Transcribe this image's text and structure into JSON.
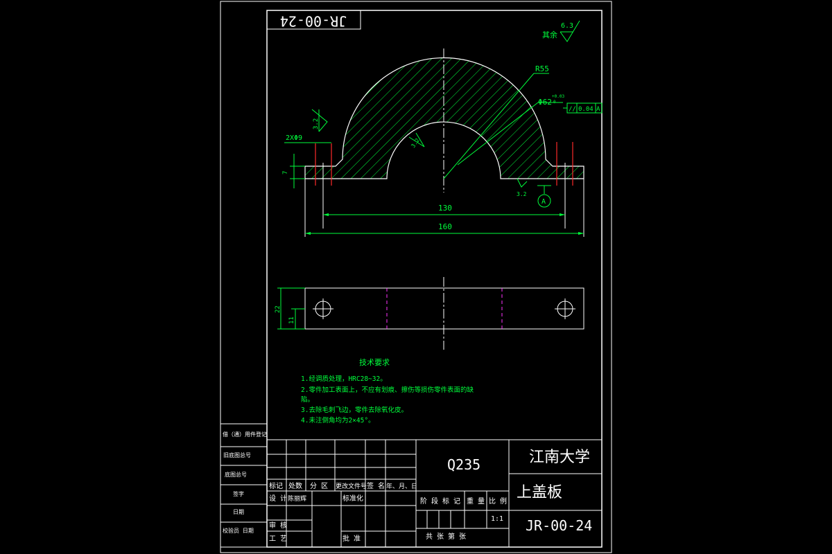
{
  "drawing_number_mirrored": "JR-00-24",
  "surface_finish_other": {
    "label": "其余",
    "value": "6.3"
  },
  "dimensions": {
    "radius_outer": "R55",
    "bore": "Φ62",
    "bore_tolerance_upper": "+0.03",
    "bore_tolerance_lower": "0",
    "holes": "2XΦ9",
    "flange_thickness": "7",
    "hole_spacing": "130",
    "overall_length": "160",
    "width": "22",
    "half_width": "11"
  },
  "roughness": {
    "flange_top": "3.2",
    "bore": "3.2",
    "bottom": "3.2"
  },
  "geometric_tolerance": {
    "symbol": "//",
    "value": "0.04",
    "datum": "A"
  },
  "datum_label": "A",
  "tech_requirements": {
    "title": "技术要求",
    "items": [
      "1.经调质处理，HRC28~32。",
      "2.零件加工表面上，不应有划痕、擦伤等损伤零件表面的缺",
      "陷。",
      "3.去除毛刺飞边，零件去除氧化皮。",
      "4.未注倒角均为2×45°。"
    ]
  },
  "left_strip": {
    "cells": [
      "借（通）用件登记",
      "旧底图总号",
      "底图总号",
      "签字",
      "日期",
      "校验员 日期"
    ]
  },
  "title_block": {
    "material": "Q235",
    "company": "江南大学",
    "part_name": "上盖板",
    "drawing_number": "JR-00-24",
    "scale": "1:1",
    "labels": {
      "mark": "标记",
      "count": "处数",
      "zone": "分 区",
      "doc_no": "更改文件号",
      "signature": "签 名",
      "date": "年、月、日",
      "design": "设 计",
      "designer": "陈丽辉",
      "standardization": "标准化",
      "stage_mark": "阶 段 标 记",
      "weight": "重 量",
      "ratio": "比 例",
      "review": "审 核",
      "process": "工 艺",
      "approve": "批 准",
      "sheets": "共    张  第    张"
    }
  }
}
